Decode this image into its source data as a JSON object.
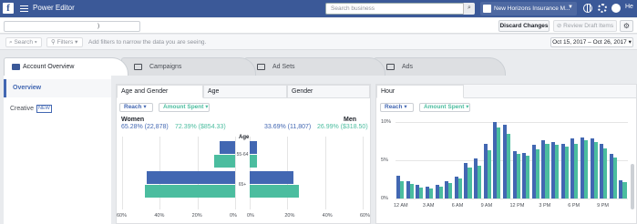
{
  "topbar": {
    "app_name": "Power Editor",
    "search_placeholder": "Search business",
    "account_name": "New Horizons Insurance M...",
    "user_initials": "He"
  },
  "toolbar": {
    "campaign_selector_label": ")",
    "discard_label": "Discard Changes",
    "review_label": "Review Draft Items"
  },
  "filterbar": {
    "search_label": "Search",
    "filters_label": "Filters",
    "hint": "Add filters to narrow the data you are seeing.",
    "date_range": "Oct 15, 2017 – Oct 26, 2017"
  },
  "tabs": [
    {
      "label": "Account Overview"
    },
    {
      "label": "Campaigns"
    },
    {
      "label": "Ad Sets"
    },
    {
      "label": "Ads"
    }
  ],
  "leftnav": {
    "overview": "Overview",
    "creative": "Creative",
    "new_badge": "NEW"
  },
  "panel_age": {
    "tabs": [
      "Age and Gender",
      "Age",
      "Gender"
    ],
    "metric1": "Reach",
    "metric2": "Amount Spent",
    "women_label": "Women",
    "men_label": "Men",
    "women_reach": "65.28% (22,878)",
    "women_spent": "72.39% ($854.33)",
    "men_reach": "33.69% (11,807)",
    "men_spent": "26.99% ($318.50)",
    "age_header": "Age",
    "age_groups": [
      "55-64",
      "65+"
    ],
    "axis_left": [
      "60%",
      "40%",
      "20%",
      "0%"
    ],
    "axis_right": [
      "0%",
      "20%",
      "40%",
      "60%"
    ]
  },
  "panel_hour": {
    "tab": "Hour",
    "metric1": "Reach",
    "metric2": "Amount Spent",
    "y_ticks": [
      "10%",
      "5%",
      "0%"
    ],
    "x_ticks": [
      "12 AM",
      "3 AM",
      "6 AM",
      "9 AM",
      "12 PM",
      "3 PM",
      "6 PM",
      "9 PM"
    ]
  },
  "colors": {
    "reach": "#4267b2",
    "spent": "#4bbd9f",
    "brand": "#3b5998"
  },
  "chart_data": [
    {
      "type": "bar",
      "title": "",
      "categories": [
        "55-64",
        "65+"
      ],
      "series": [
        {
          "name": "Reach",
          "women": [
            8,
            47
          ],
          "men": [
            4,
            23
          ]
        },
        {
          "name": "Amount Spent",
          "women": [
            11,
            48
          ],
          "men": [
            4,
            26
          ]
        }
      ],
      "xlim": [
        60,
        60
      ],
      "x_unit": "%"
    },
    {
      "type": "bar",
      "title": "",
      "categories": [
        "12 AM",
        "1 AM",
        "2 AM",
        "3 AM",
        "4 AM",
        "5 AM",
        "6 AM",
        "7 AM",
        "8 AM",
        "9 AM",
        "10 AM",
        "11 AM",
        "12 PM",
        "1 PM",
        "2 PM",
        "3 PM",
        "4 PM",
        "5 PM",
        "6 PM",
        "7 PM",
        "8 PM",
        "9 PM",
        "10 PM",
        "11 PM"
      ],
      "series": [
        {
          "name": "Reach",
          "values": [
            3.0,
            2.3,
            1.8,
            1.6,
            1.8,
            2.3,
            2.8,
            4.7,
            5.2,
            7.2,
            10.0,
            9.6,
            6.2,
            6.0,
            7.0,
            7.6,
            7.4,
            7.2,
            7.8,
            8.0,
            7.8,
            7.2,
            5.8,
            2.4
          ]
        },
        {
          "name": "Amount Spent",
          "values": [
            2.3,
            1.9,
            1.4,
            1.3,
            1.6,
            2.0,
            2.6,
            4.0,
            4.3,
            6.3,
            9.3,
            8.5,
            5.8,
            5.6,
            6.4,
            7.2,
            7.0,
            6.8,
            7.2,
            7.6,
            7.4,
            6.6,
            5.3,
            2.1
          ]
        }
      ],
      "ylim": [
        0,
        10
      ],
      "y_unit": "%"
    }
  ]
}
